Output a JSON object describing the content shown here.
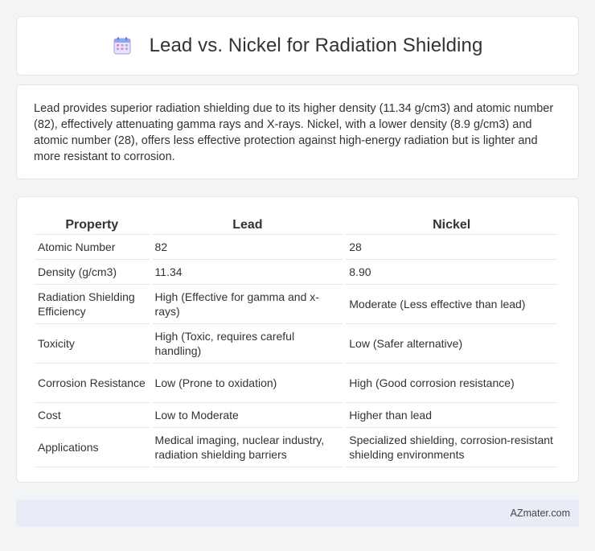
{
  "header": {
    "title": "Lead vs. Nickel for Radiation Shielding",
    "icon": "calendar-icon"
  },
  "summary": {
    "text": "Lead provides superior radiation shielding due to its higher density (11.34 g/cm3) and atomic number (82), effectively attenuating gamma rays and X-rays. Nickel, with a lower density (8.9 g/cm3) and atomic number (28), offers less effective protection against high-energy radiation but is lighter and more resistant to corrosion."
  },
  "table": {
    "headers": [
      "Property",
      "Lead",
      "Nickel"
    ],
    "rows": [
      [
        "Atomic Number",
        "82",
        "28"
      ],
      [
        "Density (g/cm3)",
        "11.34",
        "8.90"
      ],
      [
        "Radiation Shielding Efficiency",
        "High (Effective for gamma and x-rays)",
        "Moderate (Less effective than lead)"
      ],
      [
        "Toxicity",
        "High (Toxic, requires careful handling)",
        "Low (Safer alternative)"
      ],
      [
        "Corrosion Resistance",
        "Low (Prone to oxidation)",
        "High (Good corrosion resistance)"
      ],
      [
        "Cost",
        "Low to Moderate",
        "Higher than lead"
      ],
      [
        "Applications",
        "Medical imaging, nuclear industry, radiation shielding barriers",
        "Specialized shielding, corrosion-resistant shielding environments"
      ]
    ]
  },
  "footer": {
    "brand": "AZmater.com"
  }
}
